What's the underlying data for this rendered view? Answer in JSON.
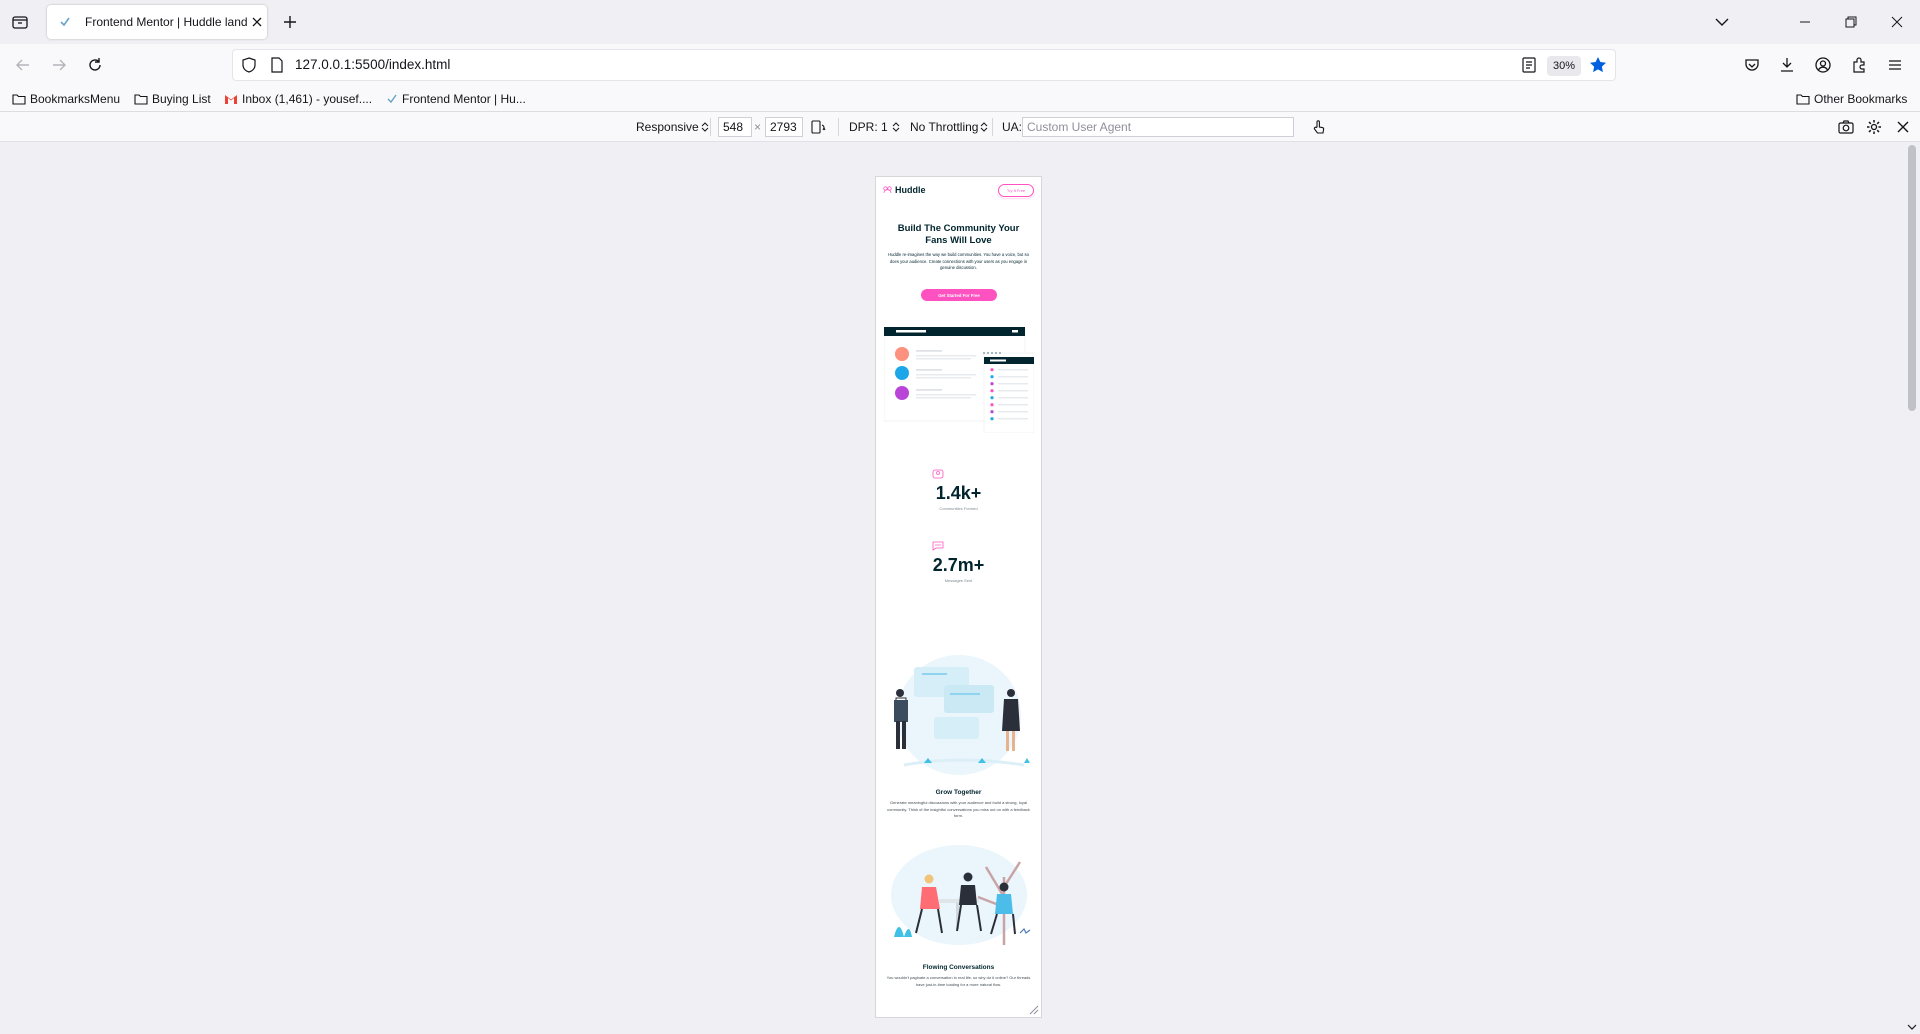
{
  "browser": {
    "tab_title": "Frontend Mentor | Huddle landing page",
    "url": "127.0.0.1:5500/index.html",
    "zoom": "30%",
    "bookmarks": [
      {
        "label": "BookmarksMenu",
        "icon": "folder-icon"
      },
      {
        "label": "Buying List",
        "icon": "folder-icon"
      },
      {
        "label": "Inbox (1,461) - yousef....",
        "icon": "gmail-icon"
      },
      {
        "label": "Frontend Mentor | Hu...",
        "icon": "huddle-favicon-icon"
      }
    ],
    "other_bookmarks": "Other Bookmarks"
  },
  "rdm": {
    "device": "Responsive",
    "width": "548",
    "times": "×",
    "height": "2793",
    "dpr": "DPR: 1",
    "throttling": "No Throttling",
    "ua_label": "UA:",
    "ua_placeholder": "Custom User Agent"
  },
  "huddle": {
    "logo": "Huddle",
    "try_button": "Try It Free",
    "hero_title": "Build The Community Your Fans Will Love",
    "hero_text": "Huddle re-imagines the way we build communities. You have a voice, but so does your audience. Create connections with your users as you engage in genuine discussion.",
    "cta": "Get Started For Free",
    "stats": [
      {
        "number": "1.4k+",
        "label": "Communities Formed",
        "icon": "communities-icon"
      },
      {
        "number": "2.7m+",
        "label": "Messages Sent",
        "icon": "messages-icon"
      }
    ],
    "features": [
      {
        "title": "Grow Together",
        "text": "Generate meaningful discussions with your audience and build a strong, loyal community. Think of the insightful conversations you miss out on with a feedback form."
      },
      {
        "title": "Flowing Conversations",
        "text": "You wouldn't paginate a conversation in real life, so why do it online? Our threads have just-in-time loading for a more natural flow."
      }
    ],
    "colors": {
      "pink": "#ff52c1",
      "dark_cyan": "#00252e"
    }
  }
}
